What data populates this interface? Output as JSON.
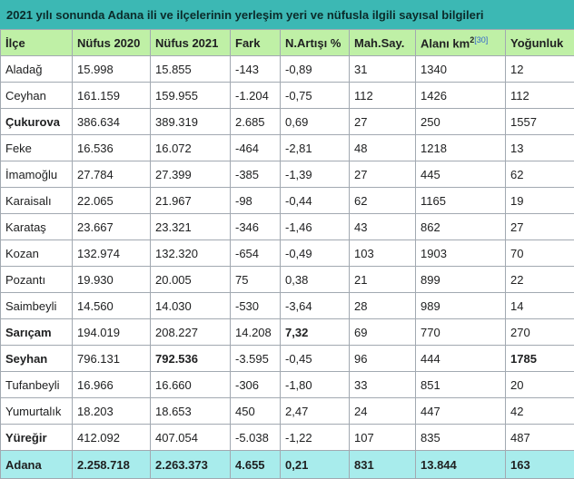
{
  "caption": "2021 yılı sonunda Adana ili ve ilçelerinin yerleşim yeri ve nüfusla ilgili sayısal bilgileri",
  "columns": [
    "İlçe",
    "Nüfus 2020",
    "Nüfus 2021",
    "Fark",
    "N.Artışı %",
    "Mah.Say.",
    "Alanı  km",
    "Yoğunluk"
  ],
  "area_sup": "2",
  "area_ref": "[30]",
  "rows": [
    {
      "ilce": "Aladağ",
      "n2020": "15.998",
      "n2021": "15.855",
      "fark": "-143",
      "artis": "-0,89",
      "mah": "31",
      "alan": "1340",
      "yog": "12",
      "bold": false
    },
    {
      "ilce": "Ceyhan",
      "n2020": "161.159",
      "n2021": "159.955",
      "fark": "-1.204",
      "artis": "-0,75",
      "mah": "112",
      "alan": "1426",
      "yog": "112",
      "bold": false
    },
    {
      "ilce": "Çukurova",
      "n2020": "386.634",
      "n2021": "389.319",
      "fark": "2.685",
      "artis": "0,69",
      "mah": "27",
      "alan": "250",
      "yog": "1557",
      "bold": true
    },
    {
      "ilce": "Feke",
      "n2020": "16.536",
      "n2021": "16.072",
      "fark": "-464",
      "artis": "-2,81",
      "mah": "48",
      "alan": "1218",
      "yog": "13",
      "bold": false
    },
    {
      "ilce": "İmamoğlu",
      "n2020": "27.784",
      "n2021": "27.399",
      "fark": "-385",
      "artis": "-1,39",
      "mah": "27",
      "alan": "445",
      "yog": "62",
      "bold": false
    },
    {
      "ilce": "Karaisalı",
      "n2020": "22.065",
      "n2021": "21.967",
      "fark": "-98",
      "artis": "-0,44",
      "mah": "62",
      "alan": "1165",
      "yog": "19",
      "bold": false
    },
    {
      "ilce": "Karataş",
      "n2020": "23.667",
      "n2021": "23.321",
      "fark": "-346",
      "artis": "-1,46",
      "mah": "43",
      "alan": "862",
      "yog": "27",
      "bold": false
    },
    {
      "ilce": "Kozan",
      "n2020": "132.974",
      "n2021": "132.320",
      "fark": "-654",
      "artis": "-0,49",
      "mah": "103",
      "alan": "1903",
      "yog": "70",
      "bold": false
    },
    {
      "ilce": "Pozantı",
      "n2020": "19.930",
      "n2021": "20.005",
      "fark": "75",
      "artis": "0,38",
      "mah": "21",
      "alan": "899",
      "yog": "22",
      "bold": false
    },
    {
      "ilce": "Saimbeyli",
      "n2020": "14.560",
      "n2021": "14.030",
      "fark": "-530",
      "artis": "-3,64",
      "mah": "28",
      "alan": "989",
      "yog": "14",
      "bold": false
    },
    {
      "ilce": "Sarıçam",
      "n2020": "194.019",
      "n2021": "208.227",
      "fark": "14.208",
      "artis": "7,32",
      "mah": "69",
      "alan": "770",
      "yog": "270",
      "bold": true,
      "bold_cells": [
        "artis"
      ]
    },
    {
      "ilce": "Seyhan",
      "n2020": "796.131",
      "n2021": "792.536",
      "fark": "-3.595",
      "artis": "-0,45",
      "mah": "96",
      "alan": "444",
      "yog": "1785",
      "bold": true,
      "bold_cells": [
        "n2021",
        "yog"
      ]
    },
    {
      "ilce": "Tufanbeyli",
      "n2020": "16.966",
      "n2021": "16.660",
      "fark": "-306",
      "artis": "-1,80",
      "mah": "33",
      "alan": "851",
      "yog": "20",
      "bold": false
    },
    {
      "ilce": "Yumurtalık",
      "n2020": "18.203",
      "n2021": "18.653",
      "fark": "450",
      "artis": "2,47",
      "mah": "24",
      "alan": "447",
      "yog": "42",
      "bold": false
    },
    {
      "ilce": "Yüreğir",
      "n2020": "412.092",
      "n2021": "407.054",
      "fark": "-5.038",
      "artis": "-1,22",
      "mah": "107",
      "alan": "835",
      "yog": "487",
      "bold": true
    }
  ],
  "total": {
    "ilce": "Adana",
    "n2020": "2.258.718",
    "n2021": "2.263.373",
    "fark": "4.655",
    "artis": "0,21",
    "mah": "831",
    "alan": "13.844",
    "yog": "163"
  },
  "colors": {
    "caption_bg": "#3cb8b4",
    "header_bg": "#bff0a6",
    "total_bg": "#a8ecec",
    "border": "#a2a9b1",
    "link": "#3366cc"
  }
}
